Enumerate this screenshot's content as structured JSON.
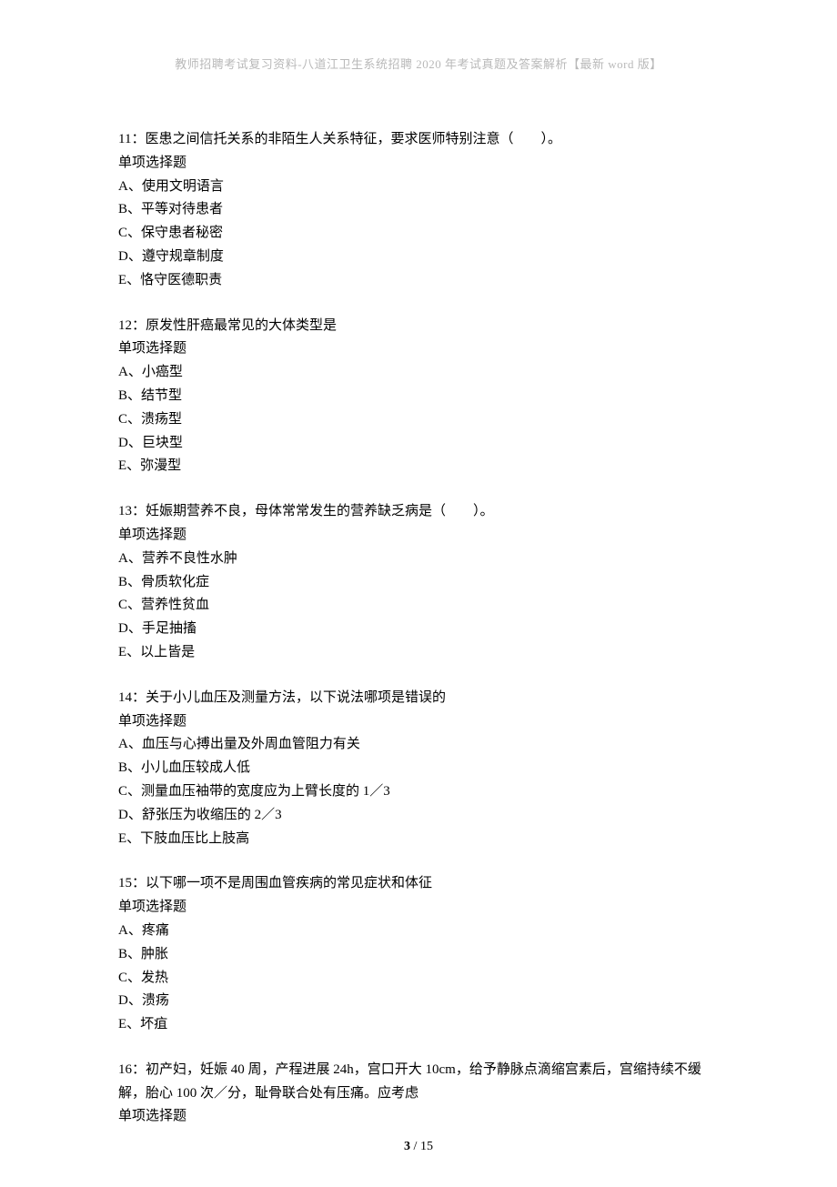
{
  "header": {
    "text": "教师招聘考试复习资料-八道江卫生系统招聘 2020 年考试真题及答案解析【最新 word 版】"
  },
  "questions": [
    {
      "number": "11",
      "stem": "：医患之间信托关系的非陌生人关系特征，要求医师特别注意（　　）。",
      "type": "单项选择题",
      "options": [
        "A、使用文明语言",
        "B、平等对待患者",
        "C、保守患者秘密",
        "D、遵守规章制度",
        "E、恪守医德职责"
      ]
    },
    {
      "number": "12",
      "stem": "：原发性肝癌最常见的大体类型是",
      "type": "单项选择题",
      "options": [
        "A、小癌型",
        "B、结节型",
        "C、溃疡型",
        "D、巨块型",
        "E、弥漫型"
      ]
    },
    {
      "number": "13",
      "stem": "：妊娠期营养不良，母体常常发生的营养缺乏病是（　　）。",
      "type": "单项选择题",
      "options": [
        "A、营养不良性水肿",
        "B、骨质软化症",
        "C、营养性贫血",
        "D、手足抽搐",
        "E、以上皆是"
      ]
    },
    {
      "number": "14",
      "stem": "：关于小儿血压及测量方法，以下说法哪项是错误的",
      "type": "单项选择题",
      "options": [
        "A、血压与心搏出量及外周血管阻力有关",
        "B、小儿血压较成人低",
        "C、测量血压袖带的宽度应为上臂长度的 1／3",
        "D、舒张压为收缩压的 2／3",
        "E、下肢血压比上肢高"
      ]
    },
    {
      "number": "15",
      "stem": "：以下哪一项不是周围血管疾病的常见症状和体征",
      "type": "单项选择题",
      "options": [
        "A、疼痛",
        "B、肿胀",
        "C、发热",
        "D、溃疡",
        "E、坏疽"
      ]
    },
    {
      "number": "16",
      "stem": "：初产妇，妊娠 40 周，产程进展 24h，宫口开大 10cm，给予静脉点滴缩宫素后，宫缩持续不缓解，胎心 100 次／分，耻骨联合处有压痛。应考虑",
      "type": "单项选择题",
      "options": []
    }
  ],
  "footer": {
    "current": "3",
    "sep": " / ",
    "total": "15"
  }
}
